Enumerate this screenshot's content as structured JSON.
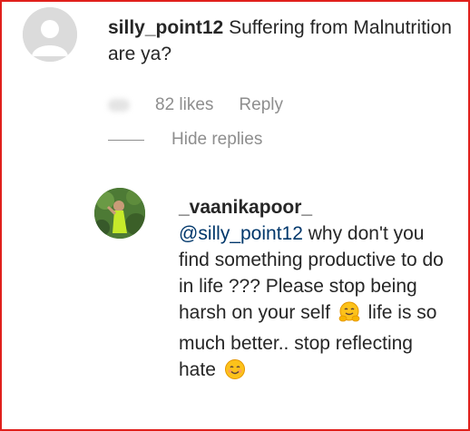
{
  "comment": {
    "username": "silly_point12",
    "text": "Suffering from Malnutrition are ya?",
    "likes": "82 likes",
    "reply_label": "Reply"
  },
  "replies_toggle": {
    "label": "Hide replies"
  },
  "reply": {
    "username": "_vaanikapoor_",
    "mention": "@silly_point12",
    "text_part1": "why don't you find something productive to do in life ??? Please stop being harsh on your self",
    "text_part2": "life is so much better.. stop reflecting hate"
  },
  "icons": {
    "generic_avatar": "default-avatar-icon",
    "emoji_hug": "hugging-face-emoji",
    "emoji_smile": "smiling-face-emoji"
  },
  "colors": {
    "frame_border": "#e0201c",
    "text": "#262626",
    "muted": "#8e8e8e",
    "mention": "#00376b"
  }
}
